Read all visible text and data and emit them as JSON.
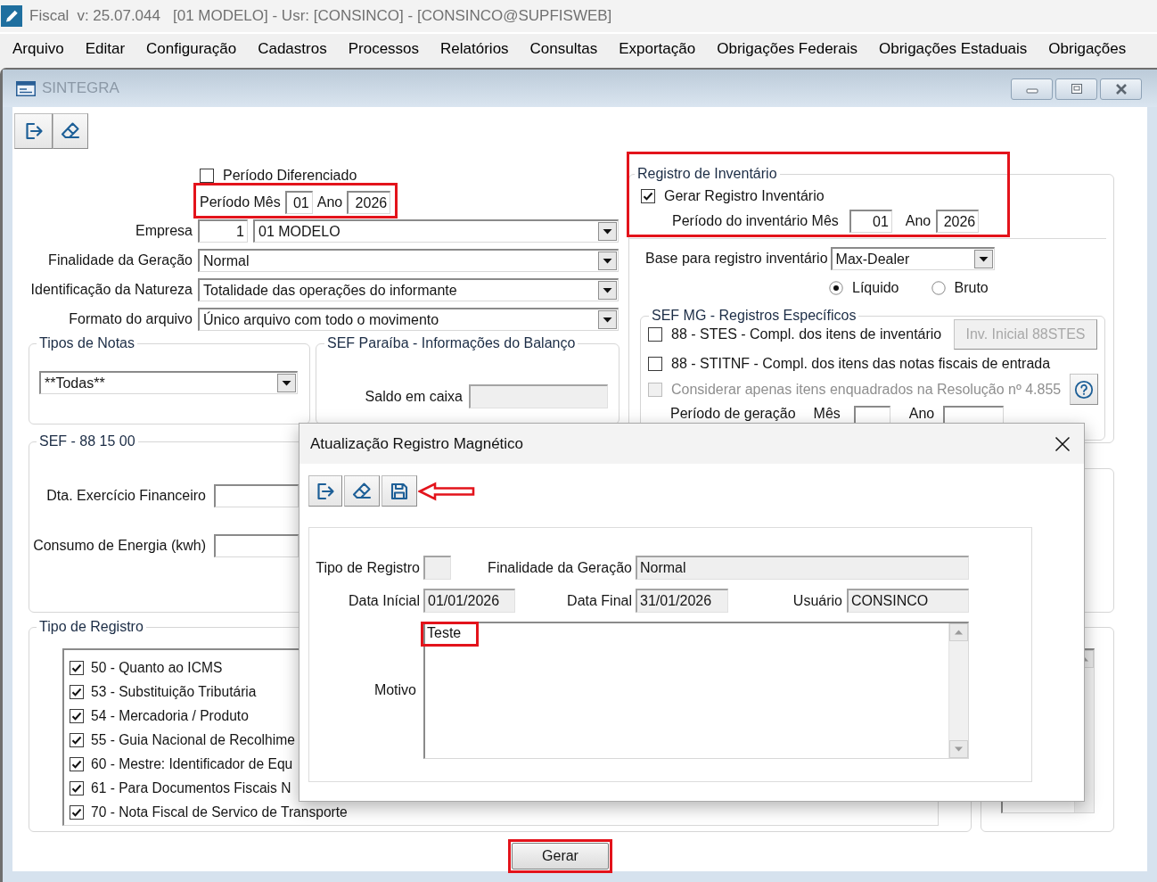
{
  "app_bar": {
    "title": "Fiscal",
    "version": "v: 25.07.044",
    "context": "[01 MODELO] - Usr: [CONSINCO] - [CONSINCO@SUPFISWEB]"
  },
  "menu": [
    "Arquivo",
    "Editar",
    "Configuração",
    "Cadastros",
    "Processos",
    "Relatórios",
    "Consultas",
    "Exportação",
    "Obrigações Federais",
    "Obrigações Estaduais",
    "Obrigações"
  ],
  "window": {
    "title": "SINTEGRA",
    "toolbar": [
      {
        "kind": "exit"
      },
      {
        "kind": "erase"
      }
    ]
  },
  "period": {
    "differentiated": {
      "label": "Período Diferenciado",
      "checked": false
    },
    "label": "Período Mês",
    "month": "01",
    "year_label": "Ano",
    "year": "2026",
    "highlighted": true
  },
  "fields": [
    {
      "kind": "code_combo",
      "label": "Empresa",
      "code": "1",
      "value": "01 MODELO"
    },
    {
      "kind": "combo",
      "label": "Finalidade da Geração",
      "value": "Normal"
    },
    {
      "kind": "combo",
      "label": "Identificação da Natureza",
      "value": "Totalidade das operações do informante"
    },
    {
      "kind": "combo",
      "label": "Formato do arquivo",
      "value": "Único arquivo com todo o movimento"
    }
  ],
  "note_types": {
    "title": "Tipos de Notas",
    "value": "**Todas**"
  },
  "sef_paraiba": {
    "title": "SEF Paraíba - Informações do Balanço",
    "field": {
      "label": "Saldo em caixa",
      "disabled": true
    }
  },
  "inventory": {
    "title": "Registro de Inventário",
    "highlighted": true,
    "generate": {
      "label": "Gerar Registro Inventário",
      "checked": true
    },
    "period_label": "Período do inventário Mês",
    "month": "01",
    "year_label": "Ano",
    "year": "2026",
    "base": {
      "label": "Base para registro inventário",
      "value": "Max-Dealer"
    },
    "valuation": [
      {
        "label": "Líquido",
        "selected": true
      },
      {
        "label": "Bruto",
        "selected": false
      }
    ]
  },
  "sef_mg": {
    "title": "SEF MG - Registros Específicos",
    "options": [
      {
        "label": "88 - STES - Compl. dos itens de inventário",
        "checked": false,
        "disabled": false,
        "action": {
          "kind": "text_button",
          "label": "Inv. Inicial 88STES",
          "disabled": true
        }
      },
      {
        "label": "88 - STITNF - Compl. dos itens das notas fiscais de entrada",
        "checked": false,
        "disabled": false
      },
      {
        "label": "Considerar apenas itens enquadrados na Resolução nº 4.855",
        "checked": false,
        "disabled": true,
        "action": {
          "kind": "help"
        }
      }
    ],
    "generation_period": {
      "label": "Período de geração",
      "month_label": "Mês",
      "year_label": "Ano"
    }
  },
  "sef_88_15_00": {
    "title": "SEF - 88 15 00",
    "fields": [
      {
        "label": "Dta. Exercício Financeiro",
        "disabled": false
      },
      {
        "label": "Consumo de Energia (kwh)",
        "disabled": false
      }
    ]
  },
  "record_types": {
    "title": "Tipo de Registro",
    "items": [
      {
        "label": "50 - Quanto ao ICMS",
        "checked": true
      },
      {
        "label": "53 - Substituição Tributária",
        "checked": true
      },
      {
        "label": "54 - Mercadoria / Produto",
        "checked": true
      },
      {
        "label": "55 - Guia Nacional de Recolhime",
        "checked": true
      },
      {
        "label": "60 - Mestre: Identificador de Equ",
        "checked": true
      },
      {
        "label": "61 - Para Documentos Fiscais N",
        "checked": true
      },
      {
        "label": "70 - Nota Fiscal de Servico de Transporte",
        "checked": true
      }
    ]
  },
  "generate_button": {
    "label": "Gerar",
    "highlighted": true
  },
  "dialog": {
    "title": "Atualização Registro Magnético",
    "toolbar": [
      {
        "kind": "exit",
        "pointed": false
      },
      {
        "kind": "erase",
        "pointed": false
      },
      {
        "kind": "save",
        "pointed": true
      }
    ],
    "record_type": {
      "label": "Tipo de Registro",
      "disabled": true
    },
    "purpose": {
      "label": "Finalidade da Geração",
      "value": "Normal",
      "disabled": true
    },
    "start_date": {
      "label": "Data Inícial",
      "value": "01/01/2026",
      "disabled": true
    },
    "end_date": {
      "label": "Data Final",
      "value": "31/01/2026",
      "disabled": true
    },
    "user": {
      "label": "Usuário",
      "value": "CONSINCO",
      "disabled": true
    },
    "reason": {
      "label": "Motivo",
      "value": "Teste",
      "highlighted": true
    }
  }
}
